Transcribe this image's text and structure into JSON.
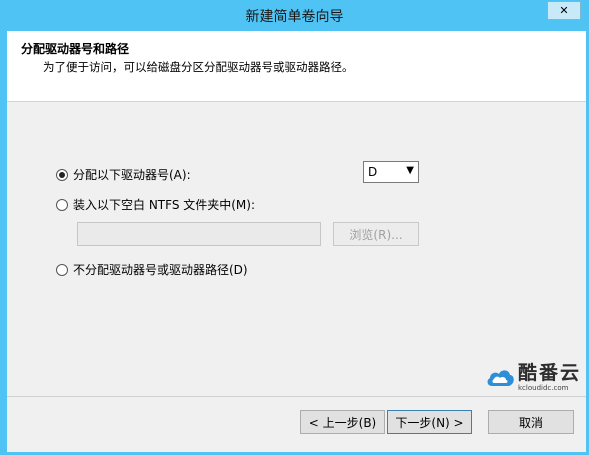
{
  "window": {
    "title": "新建简单卷向导",
    "close_symbol": "✕"
  },
  "header": {
    "title": "分配驱动器号和路径",
    "subtitle": "为了便于访问，可以给磁盘分区分配驱动器号或驱动器路径。"
  },
  "options": {
    "assign_letter_label": "分配以下驱动器号(A):",
    "assign_letter_checked": true,
    "mount_folder_label": "装入以下空白 NTFS 文件夹中(M):",
    "mount_folder_checked": false,
    "folder_path_value": "",
    "browse_label": "浏览(R)...",
    "no_letter_label": "不分配驱动器号或驱动器路径(D)",
    "no_letter_checked": false
  },
  "drive_select": {
    "value": "D",
    "arrow": "▼"
  },
  "watermark": {
    "brand": "酷番云",
    "domain": "kcloudidc.com"
  },
  "footer": {
    "back_label": "< 上一步(B)",
    "next_label": "下一步(N) >",
    "cancel_label": "取消"
  }
}
